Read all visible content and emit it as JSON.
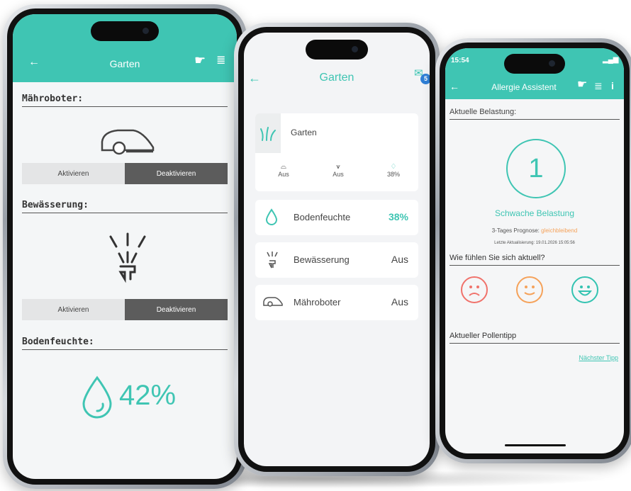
{
  "phone1": {
    "title": "Garten",
    "mower_title": "Mähroboter:",
    "water_title": "Bewässerung:",
    "moisture_title": "Bodenfeuchte:",
    "activate_label": "Aktivieren",
    "deactivate_label": "Deaktivieren",
    "moisture_value": "42%",
    "icons": [
      "back-arrow-icon",
      "hand-pointer-icon",
      "menu-icon",
      "mower-icon",
      "sprinkler-icon",
      "droplet-icon"
    ]
  },
  "phone2": {
    "title": "Garten",
    "badge": "5",
    "garden_label": "Garten",
    "mini": [
      {
        "label": "Aus"
      },
      {
        "label": "Aus"
      },
      {
        "label": "38%"
      }
    ],
    "rows": [
      {
        "label": "Bodenfeuchte",
        "value": "38%"
      },
      {
        "label": "Bewässerung",
        "value": "Aus"
      },
      {
        "label": "Mähroboter",
        "value": "Aus"
      }
    ]
  },
  "phone3": {
    "time": "15:54",
    "title": "Allergie Assistent",
    "current_load_label": "Aktuelle Belastung:",
    "level": "1",
    "level_text": "Schwache Belastung",
    "forecast_label": "3-Tages Prognose:",
    "forecast_value": "gleichbleibend",
    "updated": "Letzte Aktualisierung: 19.01.2026 15:05:56",
    "feeling_question": "Wie fühlen Sie sich aktuell?",
    "pollen_tip_label": "Aktueller Pollentipp",
    "next_tip": "Nächster Tipp"
  },
  "colors": {
    "accent": "#3fc5b3",
    "sad": "#f0726b",
    "neutral": "#f5a25a",
    "happy": "#33c3b1",
    "forecast": "#f5a25a"
  }
}
